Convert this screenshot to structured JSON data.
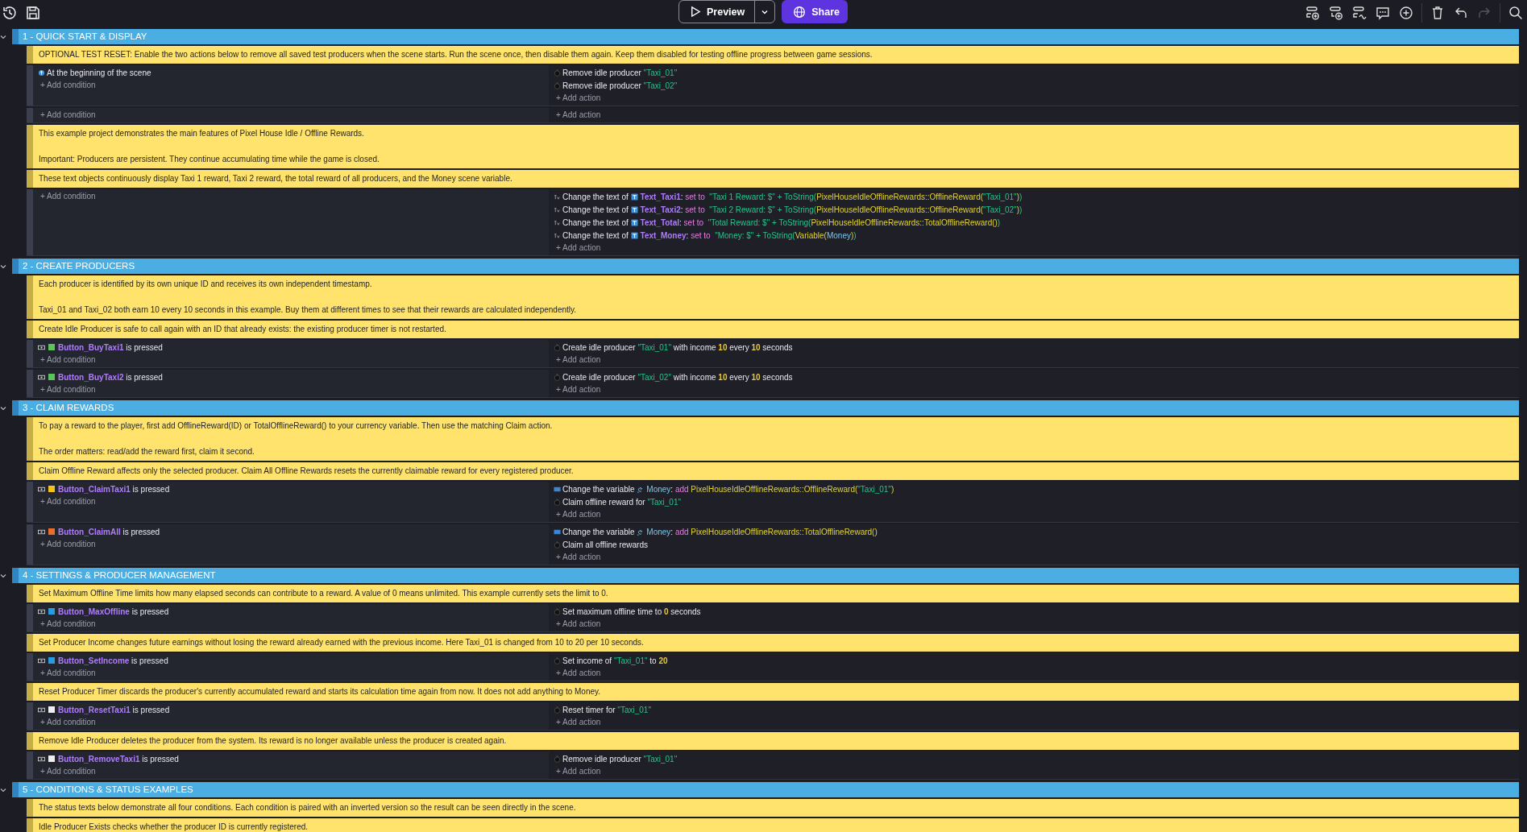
{
  "toolbar": {
    "preview": "Preview",
    "share": "Share",
    "redo": {
      "disabled": true
    }
  },
  "groups": [
    {
      "title": "1 - QUICK START & DISPLAY",
      "expanded": true,
      "events": [
        {
          "kind": "comment",
          "text": "OPTIONAL TEST RESET: Enable the two actions below to remove all saved test producers when the scene starts. Run the scene once, then disable them again. Keep them disabled for testing offline progress between game sessions."
        },
        {
          "kind": "event",
          "add_condition": "+ Add condition",
          "add_action": "+ Add action",
          "conditions": [
            {
              "kind": "scene",
              "parts": [
                {
                  "kind": "text",
                  "t": "At the beginning of the scene"
                }
              ]
            }
          ],
          "actions": [
            {
              "kind": "timer",
              "parts": [
                {
                  "kind": "text",
                  "t": "Remove idle producer "
                },
                {
                  "kind": "str",
                  "t": "\"Taxi_01\""
                }
              ]
            },
            {
              "kind": "timer",
              "parts": [
                {
                  "kind": "text",
                  "t": "Remove idle producer "
                },
                {
                  "kind": "str",
                  "t": "\"Taxi_02\""
                }
              ]
            }
          ]
        },
        {
          "kind": "event",
          "add_condition": "+ Add condition",
          "add_action": "+ Add action"
        },
        {
          "kind": "comment",
          "text": "This example project demonstrates the main features of Pixel House Idle / Offline Rewards.\n\nImportant: Producers are persistent. They continue accumulating time while the game is closed."
        },
        {
          "kind": "comment",
          "text": "These text objects continuously display Taxi 1 reward, Taxi 2 reward, the total reward of all producers, and the Money scene variable."
        },
        {
          "kind": "event",
          "add_condition": "+ Add condition",
          "add_action": "+ Add action",
          "actions": [
            {
              "kind": "text",
              "parts": [
                {
                  "kind": "text",
                  "t": "Change the text of "
                },
                {
                  "kind": "textobj",
                  "t": "Text_Taxi1"
                },
                {
                  "kind": "text",
                  "t": ": "
                },
                {
                  "kind": "op",
                  "t": "set to "
                },
                {
                  "kind": "str",
                  "t": " \"Taxi 1 Reward: $\" + ToString("
                },
                {
                  "kind": "fn",
                  "t": "PixelHouseIdleOfflineRewards::OfflineReward("
                },
                {
                  "kind": "str",
                  "t": "\"Taxi_01\""
                },
                {
                  "kind": "fn",
                  "t": ")"
                },
                {
                  "kind": "str",
                  "t": ")"
                }
              ]
            },
            {
              "kind": "text",
              "parts": [
                {
                  "kind": "text",
                  "t": "Change the text of "
                },
                {
                  "kind": "textobj",
                  "t": "Text_Taxi2"
                },
                {
                  "kind": "text",
                  "t": ": "
                },
                {
                  "kind": "op",
                  "t": "set to "
                },
                {
                  "kind": "str",
                  "t": " \"Taxi 2 Reward: $\" + ToString("
                },
                {
                  "kind": "fn",
                  "t": "PixelHouseIdleOfflineRewards::OfflineReward("
                },
                {
                  "kind": "str",
                  "t": "\"Taxi_02\""
                },
                {
                  "kind": "fn",
                  "t": ")"
                },
                {
                  "kind": "str",
                  "t": ")"
                }
              ]
            },
            {
              "kind": "text",
              "parts": [
                {
                  "kind": "text",
                  "t": "Change the text of "
                },
                {
                  "kind": "textobj",
                  "t": "Text_Total"
                },
                {
                  "kind": "text",
                  "t": ": "
                },
                {
                  "kind": "op",
                  "t": "set to "
                },
                {
                  "kind": "str",
                  "t": " \"Total Reward: $\" + ToString("
                },
                {
                  "kind": "fn",
                  "t": "PixelHouseIdleOfflineRewards::TotalOfflineReward()"
                },
                {
                  "kind": "str",
                  "t": ")"
                }
              ]
            },
            {
              "kind": "text",
              "parts": [
                {
                  "kind": "text",
                  "t": "Change the text of "
                },
                {
                  "kind": "textobj",
                  "t": "Text_Money"
                },
                {
                  "kind": "text",
                  "t": ": "
                },
                {
                  "kind": "op",
                  "t": "set to "
                },
                {
                  "kind": "str",
                  "t": " \"Money: $\" + ToString("
                },
                {
                  "kind": "fn",
                  "t": "Variable("
                },
                {
                  "kind": "var",
                  "t": "Money"
                },
                {
                  "kind": "fn",
                  "t": ")"
                },
                {
                  "kind": "str",
                  "t": ")"
                }
              ]
            }
          ]
        }
      ]
    },
    {
      "title": "2 - CREATE PRODUCERS",
      "expanded": true,
      "events": [
        {
          "kind": "comment",
          "text": "Each producer is identified by its own unique ID and receives its own independent timestamp.\n\nTaxi_01 and Taxi_02 both earn 10 every 10 seconds in this example. Buy them at different times to see that their rewards are calculated independently."
        },
        {
          "kind": "comment",
          "text": "Create Idle Producer is safe to call again with an ID that already exists: the existing producer timer is not restarted."
        },
        {
          "kind": "event",
          "add_condition": "+ Add condition",
          "add_action": "+ Add action",
          "conditions": [
            {
              "kind": "button",
              "parts": [
                {
                  "kind": "obj",
                  "color": "#5cc45c",
                  "t": "Button_BuyTaxi1"
                },
                {
                  "kind": "text",
                  "t": " is pressed"
                }
              ]
            }
          ],
          "actions": [
            {
              "kind": "timer",
              "parts": [
                {
                  "kind": "text",
                  "t": "Create idle producer "
                },
                {
                  "kind": "str",
                  "t": "\"Taxi_01\""
                },
                {
                  "kind": "text",
                  "t": " with income "
                },
                {
                  "kind": "num",
                  "t": "10"
                },
                {
                  "kind": "text",
                  "t": " every "
                },
                {
                  "kind": "num",
                  "t": "10"
                },
                {
                  "kind": "text",
                  "t": " seconds"
                }
              ]
            }
          ]
        },
        {
          "kind": "event",
          "add_condition": "+ Add condition",
          "add_action": "+ Add action",
          "conditions": [
            {
              "kind": "button",
              "parts": [
                {
                  "kind": "obj",
                  "color": "#5cc45c",
                  "t": "Button_BuyTaxi2"
                },
                {
                  "kind": "text",
                  "t": " is pressed"
                }
              ]
            }
          ],
          "actions": [
            {
              "kind": "timer",
              "parts": [
                {
                  "kind": "text",
                  "t": "Create idle producer "
                },
                {
                  "kind": "str",
                  "t": "\"Taxi_02\""
                },
                {
                  "kind": "text",
                  "t": " with income "
                },
                {
                  "kind": "num",
                  "t": "10"
                },
                {
                  "kind": "text",
                  "t": " every "
                },
                {
                  "kind": "num",
                  "t": "10"
                },
                {
                  "kind": "text",
                  "t": " seconds"
                }
              ]
            }
          ]
        }
      ]
    },
    {
      "title": "3 - CLAIM REWARDS",
      "expanded": true,
      "events": [
        {
          "kind": "comment",
          "text": "To pay a reward to the player, first add OfflineReward(ID) or TotalOfflineReward() to your currency variable. Then use the matching Claim action.\n\nThe order matters: read/add the reward first, claim it second."
        },
        {
          "kind": "comment",
          "text": "Claim Offline Reward affects only the selected producer. Claim All Offline Rewards resets the currently claimable reward for every registered producer."
        },
        {
          "kind": "event",
          "add_condition": "+ Add condition",
          "add_action": "+ Add action",
          "conditions": [
            {
              "kind": "button",
              "parts": [
                {
                  "kind": "obj",
                  "color": "#f5c21b",
                  "t": "Button_ClaimTaxi1"
                },
                {
                  "kind": "text",
                  "t": " is pressed"
                }
              ]
            }
          ],
          "actions": [
            {
              "kind": "variable",
              "parts": [
                {
                  "kind": "text",
                  "t": "Change the variable "
                },
                {
                  "kind": "scenevar",
                  "t": "Money"
                },
                {
                  "kind": "text",
                  "t": ": "
                },
                {
                  "kind": "op",
                  "t": "add "
                },
                {
                  "kind": "fn",
                  "t": "PixelHouseIdleOfflineRewards::OfflineReward("
                },
                {
                  "kind": "str",
                  "t": "\"Taxi_01\""
                },
                {
                  "kind": "fn",
                  "t": ")"
                }
              ]
            },
            {
              "kind": "timer",
              "parts": [
                {
                  "kind": "text",
                  "t": "Claim offline reward for "
                },
                {
                  "kind": "str",
                  "t": "\"Taxi_01\""
                }
              ]
            }
          ]
        },
        {
          "kind": "event",
          "add_condition": "+ Add condition",
          "add_action": "+ Add action",
          "conditions": [
            {
              "kind": "button",
              "parts": [
                {
                  "kind": "obj",
                  "color": "#e8702a",
                  "t": "Button_ClaimAll"
                },
                {
                  "kind": "text",
                  "t": " is pressed"
                }
              ]
            }
          ],
          "actions": [
            {
              "kind": "variable",
              "parts": [
                {
                  "kind": "text",
                  "t": "Change the variable "
                },
                {
                  "kind": "scenevar",
                  "t": "Money"
                },
                {
                  "kind": "text",
                  "t": ": "
                },
                {
                  "kind": "op",
                  "t": "add "
                },
                {
                  "kind": "fn",
                  "t": "PixelHouseIdleOfflineRewards::TotalOfflineReward()"
                }
              ]
            },
            {
              "kind": "timer",
              "parts": [
                {
                  "kind": "text",
                  "t": "Claim all offline rewards"
                }
              ]
            }
          ]
        }
      ]
    },
    {
      "title": "4 - SETTINGS & PRODUCER MANAGEMENT",
      "expanded": true,
      "events": [
        {
          "kind": "comment",
          "text": "Set Maximum Offline Time limits how many elapsed seconds can contribute to a reward. A value of 0 means unlimited. This example currently sets the limit to 0."
        },
        {
          "kind": "event",
          "add_condition": "+ Add condition",
          "add_action": "+ Add action",
          "conditions": [
            {
              "kind": "button",
              "parts": [
                {
                  "kind": "obj",
                  "color": "#2a9be0",
                  "t": "Button_MaxOffline"
                },
                {
                  "kind": "text",
                  "t": " is pressed"
                }
              ]
            }
          ],
          "actions": [
            {
              "kind": "timer",
              "parts": [
                {
                  "kind": "text",
                  "t": "Set maximum offline time to "
                },
                {
                  "kind": "num",
                  "t": "0"
                },
                {
                  "kind": "text",
                  "t": " seconds"
                }
              ]
            }
          ]
        },
        {
          "kind": "comment",
          "text": "Set Producer Income changes future earnings without losing the reward already earned with the previous income. Here Taxi_01 is changed from 10 to 20 per 10 seconds."
        },
        {
          "kind": "event",
          "add_condition": "+ Add condition",
          "add_action": "+ Add action",
          "conditions": [
            {
              "kind": "button",
              "parts": [
                {
                  "kind": "obj",
                  "color": "#2a9be0",
                  "t": "Button_SetIncome"
                },
                {
                  "kind": "text",
                  "t": " is pressed"
                }
              ]
            }
          ],
          "actions": [
            {
              "kind": "timer",
              "parts": [
                {
                  "kind": "text",
                  "t": "Set income of "
                },
                {
                  "kind": "str",
                  "t": "\"Taxi_01\""
                },
                {
                  "kind": "text",
                  "t": " to "
                },
                {
                  "kind": "num",
                  "t": "20"
                }
              ]
            }
          ]
        },
        {
          "kind": "comment",
          "text": "Reset Producer Timer discards the producer's currently accumulated reward and starts its calculation time again from now. It does not add anything to Money."
        },
        {
          "kind": "event",
          "add_condition": "+ Add condition",
          "add_action": "+ Add action",
          "conditions": [
            {
              "kind": "button",
              "parts": [
                {
                  "kind": "obj",
                  "color": "#eeeeee",
                  "t": "Button_ResetTaxi1"
                },
                {
                  "kind": "text",
                  "t": " is pressed"
                }
              ]
            }
          ],
          "actions": [
            {
              "kind": "timer",
              "parts": [
                {
                  "kind": "text",
                  "t": "Reset timer for "
                },
                {
                  "kind": "str",
                  "t": "\"Taxi_01\""
                }
              ]
            }
          ]
        },
        {
          "kind": "comment",
          "text": "Remove Idle Producer deletes the producer from the system. Its reward is no longer available unless the producer is created again."
        },
        {
          "kind": "event",
          "add_condition": "+ Add condition",
          "add_action": "+ Add action",
          "conditions": [
            {
              "kind": "button",
              "parts": [
                {
                  "kind": "obj",
                  "color": "#eeeeee",
                  "t": "Button_RemoveTaxi1"
                },
                {
                  "kind": "text",
                  "t": " is pressed"
                }
              ]
            }
          ],
          "actions": [
            {
              "kind": "timer",
              "parts": [
                {
                  "kind": "text",
                  "t": "Remove idle producer "
                },
                {
                  "kind": "str",
                  "t": "\"Taxi_01\""
                }
              ]
            }
          ]
        }
      ]
    },
    {
      "title": "5 - CONDITIONS & STATUS EXAMPLES",
      "expanded": true,
      "events": [
        {
          "kind": "comment",
          "text": "The status texts below demonstrate all four conditions. Each condition is paired with an inverted version so the result can be seen directly in the scene."
        },
        {
          "kind": "comment",
          "text": "Idle Producer Exists checks whether the producer ID is currently registered."
        }
      ]
    }
  ]
}
